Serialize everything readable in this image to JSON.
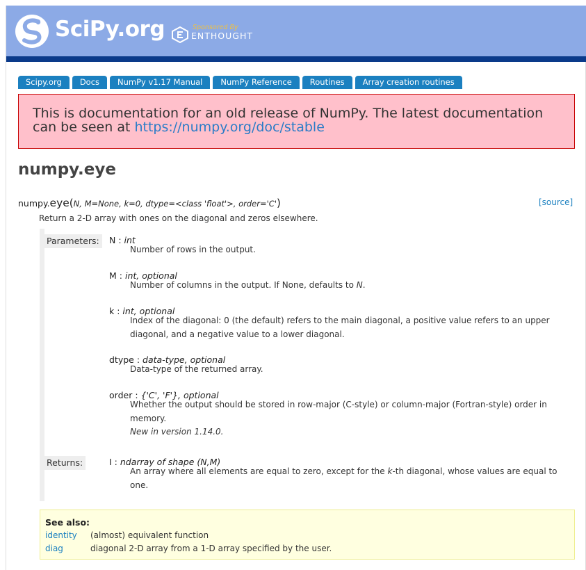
{
  "header": {
    "logo_text": "SciPy.org",
    "sponsor_by": "Sponsored By",
    "sponsor_name": "ENTHOUGHT"
  },
  "breadcrumb": [
    "Scipy.org",
    "Docs",
    "NumPy v1.17 Manual",
    "NumPy Reference",
    "Routines",
    "Array creation routines"
  ],
  "notice": {
    "text": "This is documentation for an old release of NumPy. The latest documentation can be seen at ",
    "link": "https://numpy.org/doc/stable"
  },
  "page_title": "numpy.eye",
  "signature": {
    "module": "numpy.",
    "function": "eye",
    "open_paren": "(",
    "params": "N, M=None, k=0, dtype=<class 'float'>, order='C'",
    "close_paren": ")",
    "source_label": "[source]"
  },
  "summary": "Return a 2-D array with ones on the diagonal and zeros elsewhere.",
  "parameters_label": "Parameters:",
  "returns_label": "Returns:",
  "parameters": [
    {
      "name": "N",
      "sep": " : ",
      "type": "int",
      "desc": "Number of rows in the output."
    },
    {
      "name": "M",
      "sep": " : ",
      "type": "int, optional",
      "desc": "Number of columns in the output. If None, defaults to ",
      "desc_em": "N",
      "desc_end": "."
    },
    {
      "name": "k",
      "sep": " : ",
      "type": "int, optional",
      "desc": "Index of the diagonal: 0 (the default) refers to the main diagonal, a positive value refers to an upper diagonal, and a negative value to a lower diagonal."
    },
    {
      "name": "dtype",
      "sep": " : ",
      "type": "data-type, optional",
      "desc": "Data-type of the returned array."
    },
    {
      "name": "order",
      "sep": " : ",
      "type": "{'C', 'F'}, optional",
      "desc": "Whether the output should be stored in row-major (C-style) or column-major (Fortran-style) order in memory.",
      "note": "New in version 1.14.0."
    }
  ],
  "returns": {
    "name": "I",
    "sep": " : ",
    "type": "ndarray of shape (N,M)",
    "desc_a": "An array where all elements are equal to zero, except for the ",
    "desc_em": "k",
    "desc_b": "-th diagonal, whose values are equal to one."
  },
  "see_also": {
    "title": "See also:",
    "items": [
      {
        "link": "identity",
        "desc": "(almost) equivalent function"
      },
      {
        "link": "diag",
        "desc": "diagonal 2-D array from a 1-D array specified by the user."
      }
    ]
  },
  "colors": {
    "header": "#8caae6",
    "header_bar": "#0a3a8a",
    "breadcrumb": "#1b80c0",
    "notice_bg": "#ffc0cb",
    "notice_border": "#c70000",
    "link": "#1b80c0",
    "see_also_bg": "#ffffe0"
  },
  "icons": {
    "logo": "scipy-snake-icon",
    "sponsor": "enthought-e-icon"
  }
}
